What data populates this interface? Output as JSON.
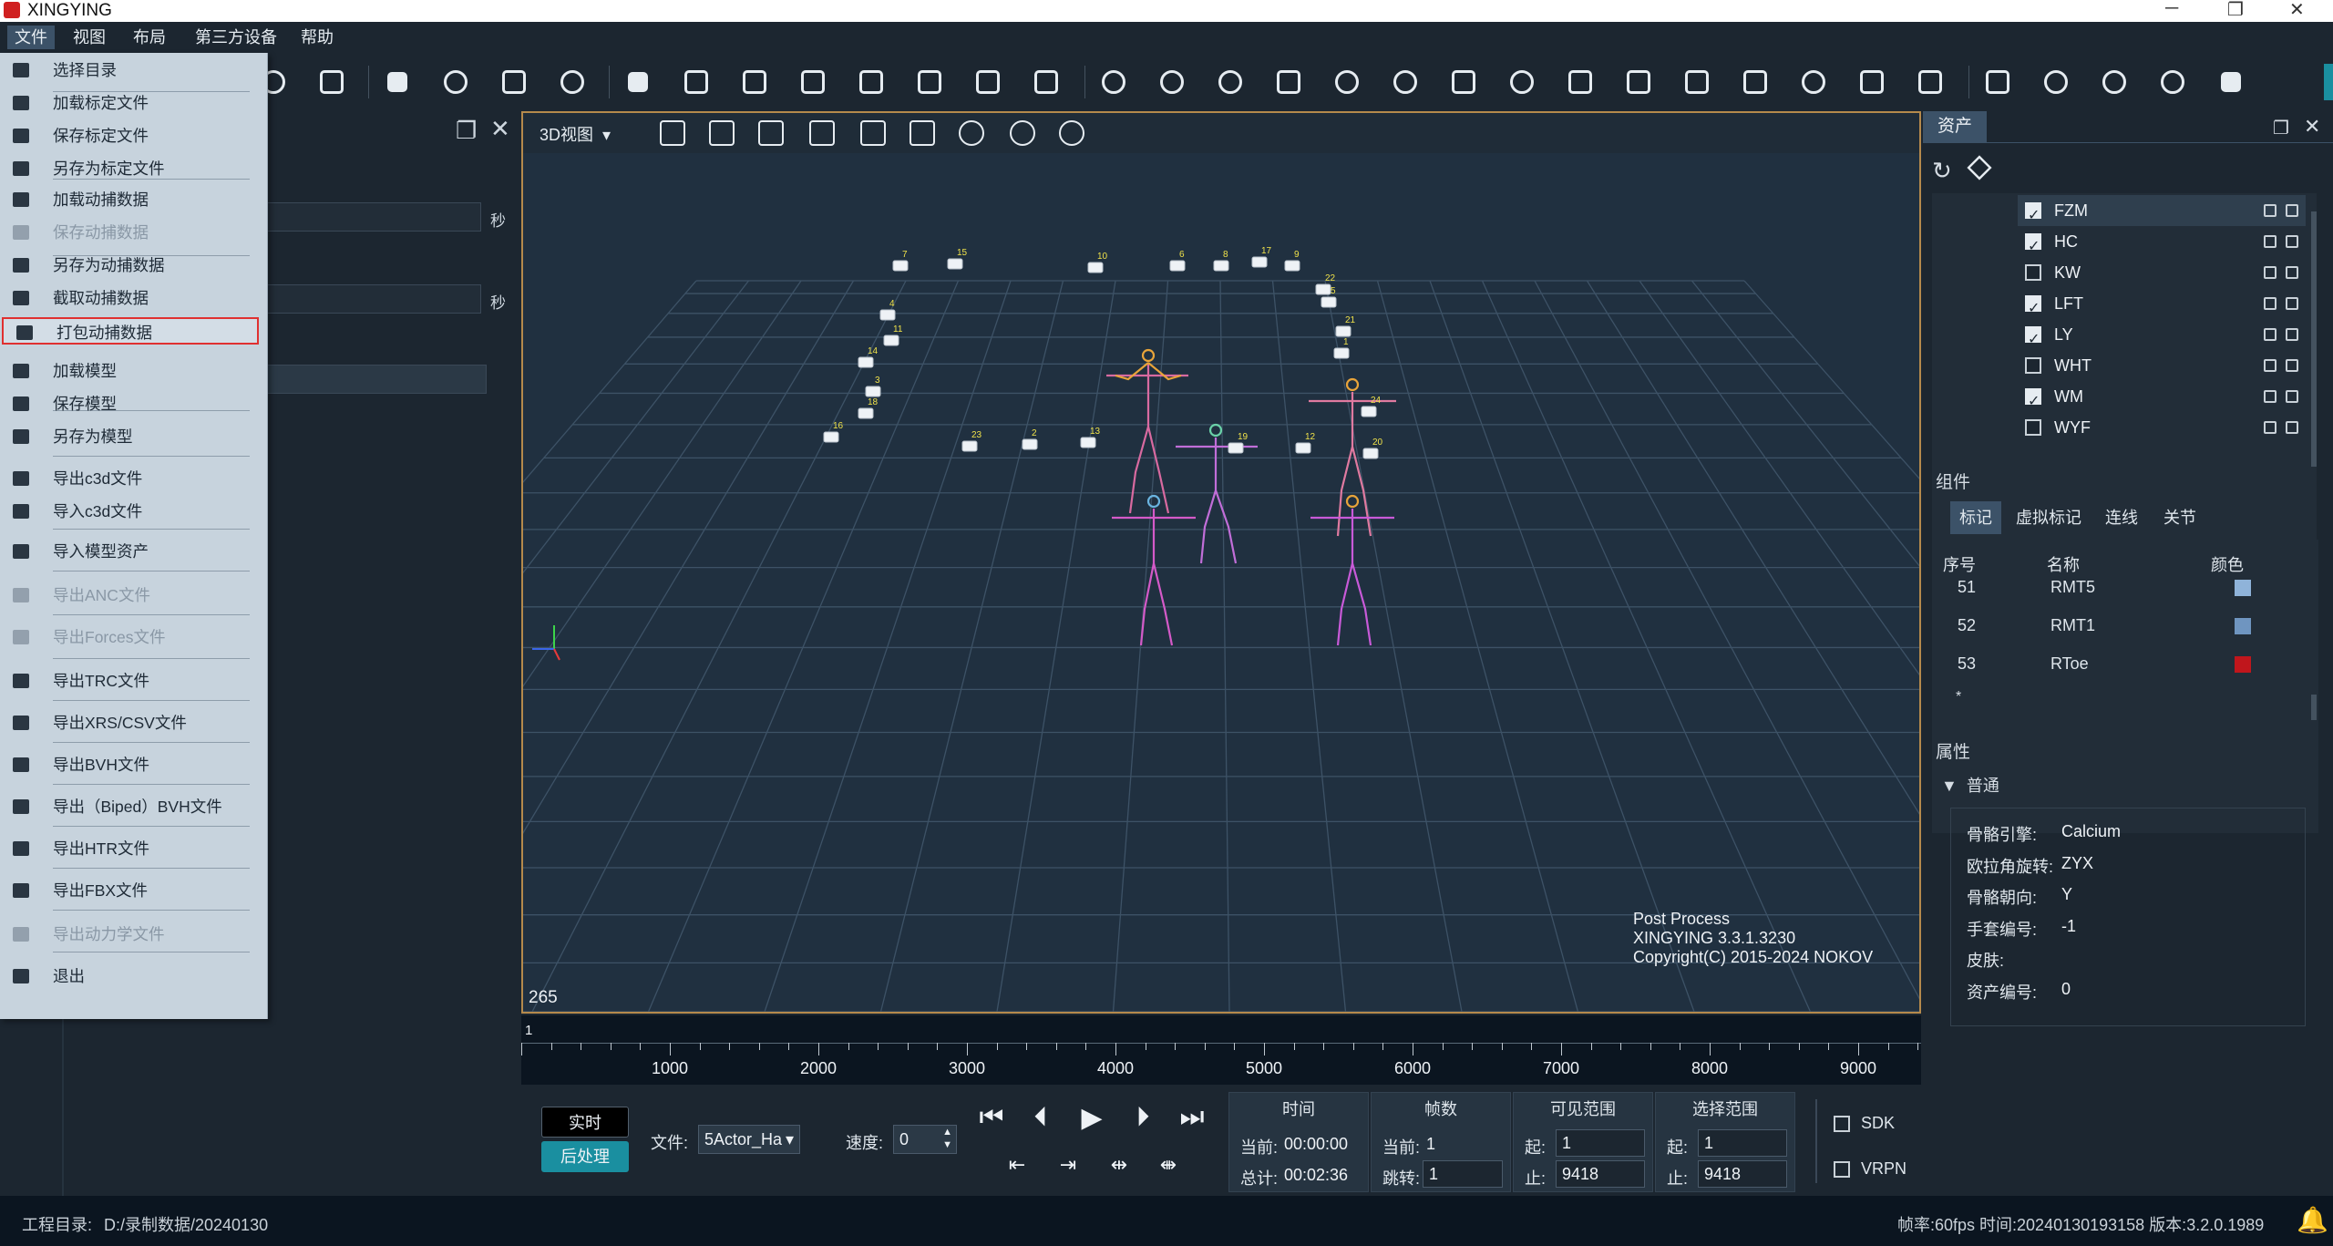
{
  "window": {
    "title": "XINGYING"
  },
  "menubar": {
    "items": [
      "文件",
      "视图",
      "布局",
      "第三方设备",
      "帮助"
    ]
  },
  "file_menu": {
    "items": [
      {
        "label": "选择目录",
        "disabled": false,
        "icon": "folder-icon"
      },
      {
        "label": "加载标定文件",
        "disabled": false,
        "icon": "wand-icon"
      },
      {
        "label": "保存标定文件",
        "disabled": false,
        "icon": "save-icon"
      },
      {
        "label": "另存为标定文件",
        "disabled": false,
        "icon": "save-as-icon"
      },
      {
        "label": "加载动捕数据",
        "disabled": false,
        "icon": "cap-load-icon"
      },
      {
        "label": "保存动捕数据",
        "disabled": true,
        "icon": "cap-save-icon"
      },
      {
        "label": "另存为动捕数据",
        "disabled": false,
        "icon": "cap-save-as-icon"
      },
      {
        "label": "截取动捕数据",
        "disabled": false,
        "icon": "cap-cut-icon"
      },
      {
        "label": "打包动捕数据",
        "disabled": false,
        "icon": "cap-pack-icon",
        "selected": true
      },
      {
        "label": "加载模型",
        "disabled": false,
        "icon": "model-load-icon"
      },
      {
        "label": "保存模型",
        "disabled": false,
        "icon": "model-save-icon"
      },
      {
        "label": "另存为模型",
        "disabled": false,
        "icon": "model-save-as-icon"
      },
      {
        "label": "导出c3d文件",
        "disabled": false,
        "icon": "c3d-export-icon"
      },
      {
        "label": "导入c3d文件",
        "disabled": false,
        "icon": "c3d-import-icon"
      },
      {
        "label": "导入模型资产",
        "disabled": false,
        "icon": "asset-import-icon"
      },
      {
        "label": "导出ANC文件",
        "disabled": true,
        "icon": "anc-export-icon"
      },
      {
        "label": "导出Forces文件",
        "disabled": true,
        "icon": "forces-export-icon"
      },
      {
        "label": "导出TRC文件",
        "disabled": false,
        "icon": "trc-export-icon"
      },
      {
        "label": "导出XRS/CSV文件",
        "disabled": false,
        "icon": "xrs-export-icon"
      },
      {
        "label": "导出BVH文件",
        "disabled": false,
        "icon": "bvh-export-icon"
      },
      {
        "label": "导出（Biped）BVH文件",
        "disabled": false,
        "icon": "biped-bvh-export-icon"
      },
      {
        "label": "导出HTR文件",
        "disabled": false,
        "icon": "htr-export-icon"
      },
      {
        "label": "导出FBX文件",
        "disabled": false,
        "icon": "fbx-export-icon"
      },
      {
        "label": "导出动力学文件",
        "disabled": true,
        "icon": "dynamics-export-icon"
      },
      {
        "label": "退出",
        "disabled": false,
        "icon": "exit-icon"
      }
    ]
  },
  "left_panel": {
    "unit_a": "秒",
    "unit_b": "秒"
  },
  "viewport": {
    "view_select": "3D视图",
    "frame_counter": "265",
    "info_lines": [
      "Post Process",
      "XINGYING 3.3.1.3230",
      "Copyright(C) 2015-2024 NOKOV"
    ],
    "camera_ids": [
      "7",
      "15",
      "10",
      "6",
      "8",
      "17",
      "9",
      "22",
      "5",
      "21",
      "1",
      "4",
      "11",
      "14",
      "3",
      "18",
      "16",
      "23",
      "2",
      "13",
      "19",
      "12",
      "24",
      "20"
    ]
  },
  "timeline": {
    "start": "1",
    "labels": [
      "1000",
      "2000",
      "3000",
      "4000",
      "5000",
      "6000",
      "7000",
      "8000",
      "9000"
    ]
  },
  "playback": {
    "realtime_label": "实时",
    "postprocess_label": "后处理",
    "file_label": "文件:",
    "file_value": "5Actor_Ha",
    "speed_label": "速度:",
    "speed_value": "0",
    "time": {
      "header": "时间",
      "current_label": "当前:",
      "current_value": "00:00:00",
      "total_label": "总计:",
      "total_value": "00:02:36"
    },
    "frames": {
      "header": "帧数",
      "current_label": "当前:",
      "current_value": "1",
      "jump_label": "跳转:",
      "jump_value": "1"
    },
    "visible_range": {
      "header": "可见范围",
      "start_label": "起:",
      "start_value": "1",
      "end_label": "止:",
      "end_value": "9418"
    },
    "select_range": {
      "header": "选择范围",
      "start_label": "起:",
      "start_value": "1",
      "end_label": "止:",
      "end_value": "9418"
    },
    "sdk_label": "SDK",
    "vrpn_label": "VRPN"
  },
  "right_panel": {
    "tab": "资产",
    "assets": [
      {
        "name": "FZM",
        "checked": true
      },
      {
        "name": "HC",
        "checked": true
      },
      {
        "name": "KW",
        "checked": false
      },
      {
        "name": "LFT",
        "checked": true
      },
      {
        "name": "LY",
        "checked": true
      },
      {
        "name": "WHT",
        "checked": false
      },
      {
        "name": "WM",
        "checked": true
      },
      {
        "name": "WYF",
        "checked": false
      }
    ],
    "components_title": "组件",
    "component_tabs": [
      "标记",
      "虚拟标记",
      "连线",
      "关节"
    ],
    "columns": {
      "index": "序号",
      "name": "名称",
      "color": "颜色"
    },
    "markers": [
      {
        "index": "51",
        "name": "RMT5",
        "color": "#8fb3d9"
      },
      {
        "index": "52",
        "name": "RMT1",
        "color": "#6f95c0"
      },
      {
        "index": "53",
        "name": "RToe",
        "color": "#c0161c"
      }
    ],
    "marker_new_row": "*",
    "properties_title": "属性",
    "general_label": "普通",
    "props": [
      {
        "label": "骨骼引擎:",
        "value": "Calcium"
      },
      {
        "label": "欧拉角旋转:",
        "value": "ZYX"
      },
      {
        "label": "骨骼朝向:",
        "value": "Y"
      },
      {
        "label": "手套编号:",
        "value": "-1"
      },
      {
        "label": "皮肤:",
        "value": ""
      },
      {
        "label": "资产编号:",
        "value": "0"
      }
    ]
  },
  "status": {
    "project_label": "工程目录:",
    "project_path": "D:/录制数据/20240130",
    "right_text": "帧率:60fps 时间:20240130193158 版本:3.2.0.1989"
  },
  "colors": {
    "accent": "#1a8fa0",
    "selection_border": "#e03030",
    "viewport_border": "#b58a4c"
  }
}
